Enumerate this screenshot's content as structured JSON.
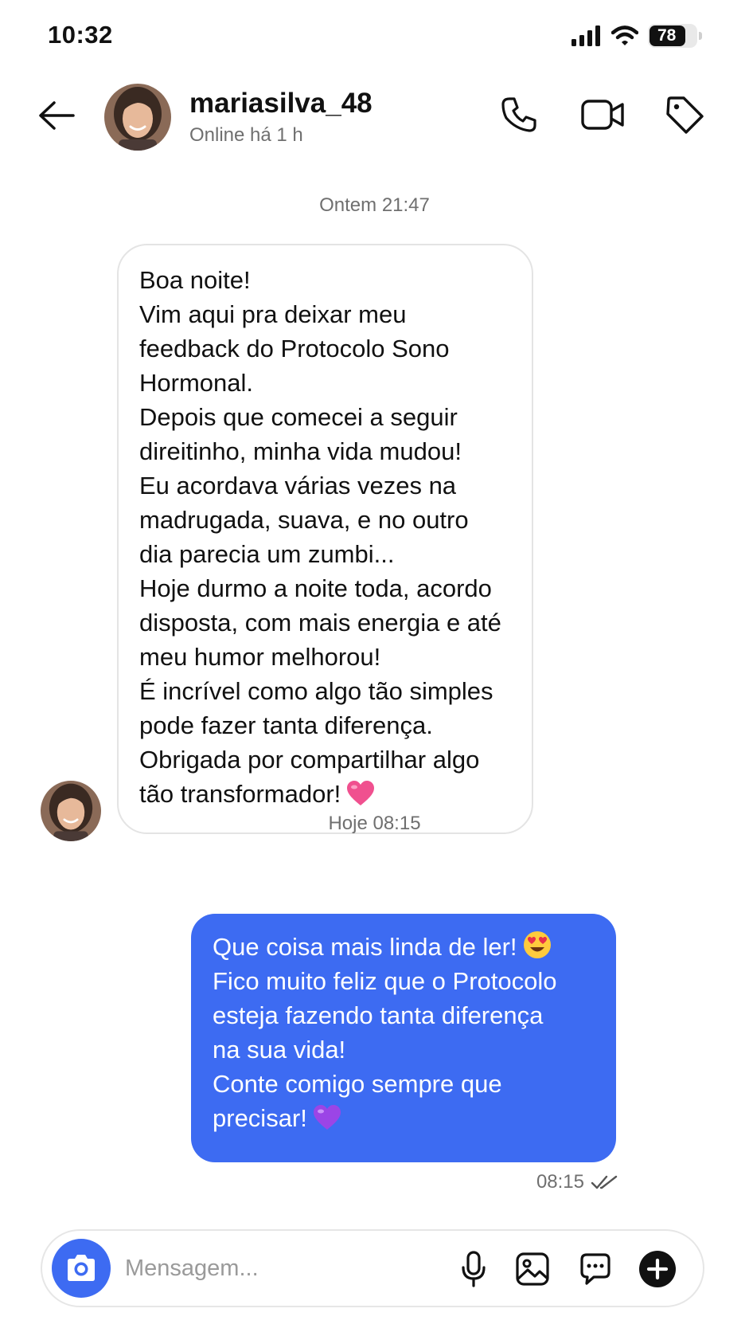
{
  "status_bar": {
    "time": "10:32",
    "battery_level": "78",
    "battery_fraction": 0.78
  },
  "header": {
    "contact_name": "mariasilva_48",
    "contact_status": "Online há 1 h",
    "icons": [
      "back-arrow-icon",
      "phone-icon",
      "video-camera-icon",
      "tag-icon"
    ]
  },
  "conversation": {
    "incoming_timestamp": "Ontem 21:47",
    "incoming_lines": [
      "Boa noite!",
      "Vim aqui pra deixar meu",
      "feedback do Protocolo Sono",
      "Hormonal.",
      "Depois que comecei a seguir",
      "direitinho, minha vida mudou!",
      "Eu acordava várias vezes na",
      "madrugada, suava, e no outro",
      "dia parecia um zumbi...",
      "Hoje durmo a noite toda, acordo",
      "disposta, com mais energia e até",
      "meu humor melhorou!",
      "É incrível como algo tão simples",
      "pode fazer tanta diferença.",
      "Obrigada por compartilhar algo",
      "tão transformador!"
    ],
    "incoming_emoji": "pink-heart",
    "outgoing_timestamp": "Hoje 08:15",
    "outgoing_lines": [
      "Que coisa mais linda de ler!",
      "Fico muito feliz que o Protocolo",
      "esteja fazendo tanta diferença",
      "na sua vida!",
      "Conte comigo sempre que",
      "precisar!"
    ],
    "outgoing_emojis": [
      "heart-eyes",
      "purple-heart"
    ],
    "sent_time": "08:15",
    "read_status": "double-check"
  },
  "composer": {
    "placeholder": "Mensagem...",
    "icons": [
      "camera-icon",
      "microphone-icon",
      "image-icon",
      "chat-bubble-icon",
      "plus-circle-icon"
    ]
  },
  "colors": {
    "accent": "#3d6bf2",
    "outgoing_bubble": "#3d6bf2",
    "incoming_border": "#e4e4e4",
    "muted_text": "#6f6f6f",
    "pink_heart": "#f0508f",
    "purple_heart": "#9b45e6"
  }
}
